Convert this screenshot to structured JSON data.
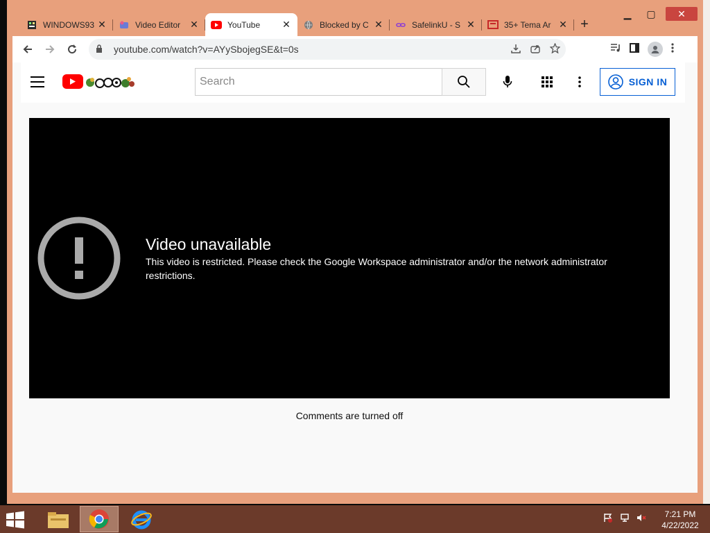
{
  "window": {
    "caption": {
      "minimize": "▁",
      "maximize": "▢",
      "close": "✕"
    }
  },
  "tabs": [
    {
      "title": "WINDOWS93",
      "icon": "windows93-favicon",
      "active": false
    },
    {
      "title": "Video Editor",
      "icon": "video-editor-favicon",
      "active": false
    },
    {
      "title": "YouTube",
      "icon": "youtube-favicon",
      "active": true
    },
    {
      "title": "Blocked by C",
      "icon": "globe-favicon",
      "active": false
    },
    {
      "title": "SafelinkU - S",
      "icon": "safelink-favicon",
      "active": false
    },
    {
      "title": "35+ Tema Ar",
      "icon": "slides-favicon",
      "active": false
    }
  ],
  "new_tab_label": "+",
  "toolbar": {
    "url": "youtube.com/watch?v=AYySbojegSE&t=0s"
  },
  "youtube": {
    "search_placeholder": "Search",
    "sign_in_label": "SIGN IN",
    "error_title": "Video unavailable",
    "error_message": "This video is restricted. Please check the Google Workspace administrator and/or the network administrator restrictions.",
    "comments_status": "Comments are turned off"
  },
  "taskbar": {
    "time": "7:21 PM",
    "date": "4/22/2022"
  },
  "colors": {
    "accent_frame": "#e8a07c",
    "youtube_red": "#ff0000",
    "signin_blue": "#065fd4",
    "taskbar": "#6b3a2a"
  }
}
